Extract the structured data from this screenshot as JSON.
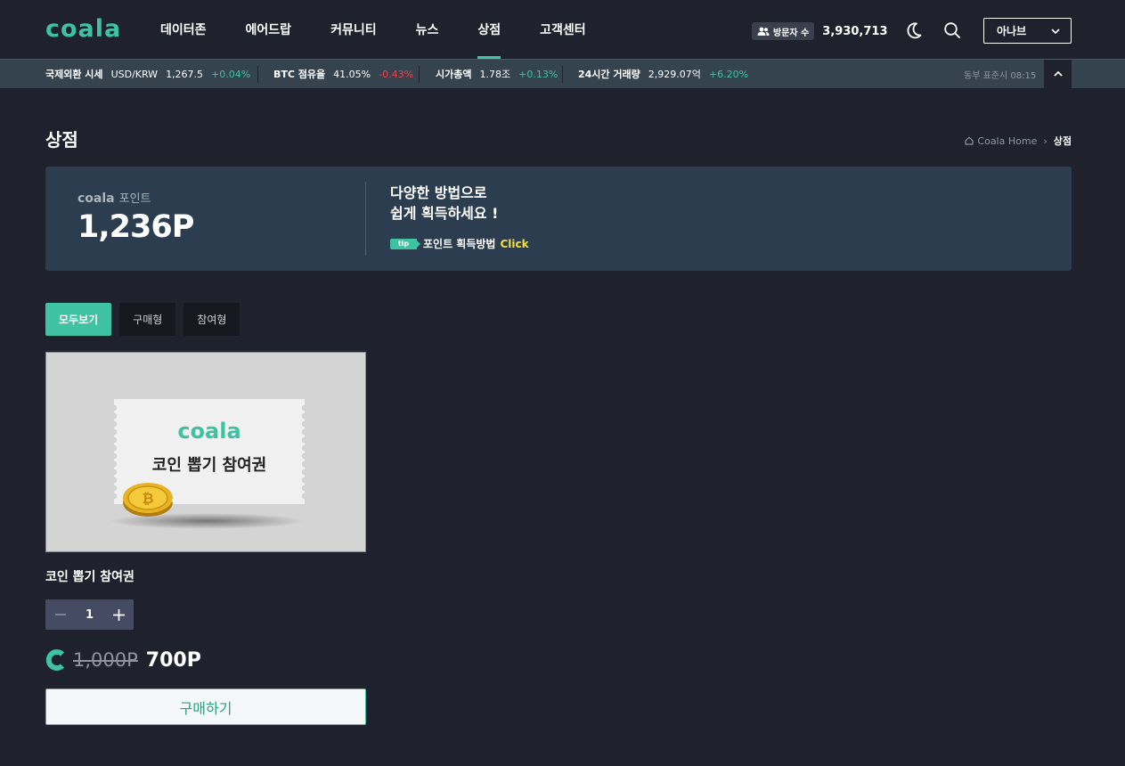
{
  "header": {
    "logo": "coala",
    "nav": [
      {
        "label": "데이터존",
        "active": false
      },
      {
        "label": "에어드랍",
        "active": false
      },
      {
        "label": "커뮤니티",
        "active": false
      },
      {
        "label": "뉴스",
        "active": false
      },
      {
        "label": "상점",
        "active": true
      },
      {
        "label": "고객센터",
        "active": false
      }
    ],
    "visitor_label": "방문자 수",
    "visitor_count": "3,930,713",
    "user_name": "아나브",
    "icons": [
      "users-icon",
      "moon-icon",
      "search-icon",
      "chevron-down-icon"
    ]
  },
  "ticker": {
    "forex": {
      "label": "국제외환 시세",
      "key": "USD/KRW",
      "value": "1,267.5",
      "change": "+0.04%"
    },
    "btc": {
      "label": "BTC 점유율",
      "value": "41.05%",
      "change": "-0.43%"
    },
    "market_cap": {
      "label": "시가총액",
      "value": "1.78조",
      "change": "+0.13%"
    },
    "volume": {
      "label": "24시간 거래량",
      "value": "2,929.07억",
      "change": "+6.20%"
    },
    "time": "동부 표준시 08:15"
  },
  "page": {
    "title": "상점",
    "breadcrumb_home": "Coala Home",
    "breadcrumb_current": "상점"
  },
  "points": {
    "brand": "coala",
    "label": "포인트",
    "value": "1,236P",
    "promo_line1": "다양한 방법으로",
    "promo_line2": "쉽게 획득하세요 !",
    "tip_badge": "tip",
    "tip_text": "포인트 획득방법",
    "tip_link": "Click"
  },
  "tabs": [
    {
      "label": "모두보기",
      "active": true
    },
    {
      "label": "구매형",
      "active": false
    },
    {
      "label": "참여형",
      "active": false
    }
  ],
  "product": {
    "image_brand": "coala",
    "image_title": "코인 뽑기 참여권",
    "name": "코인 뽑기 참여권",
    "quantity": "1",
    "original_price": "1,000P",
    "sale_price": "700P",
    "buy_label": "구매하기"
  },
  "colors": {
    "accent": "#3ec2a2",
    "background": "#1f212d",
    "banner": "#2b3d4f",
    "up": "#3ec2a2",
    "down": "#f0414a",
    "highlight": "#f5e13b"
  }
}
